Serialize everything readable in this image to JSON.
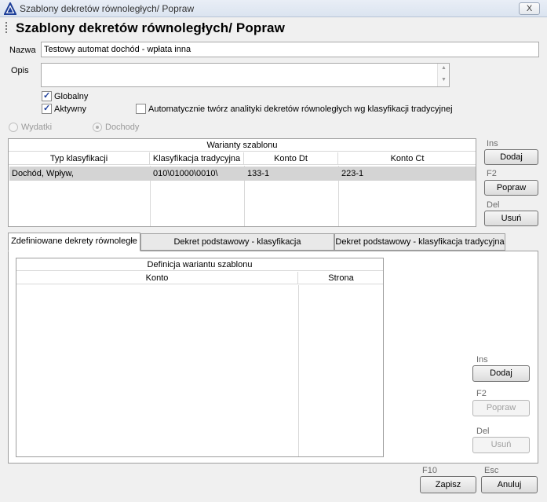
{
  "window": {
    "title": "Szablony dekretów równoległych/ Popraw",
    "close_label": "X"
  },
  "page_title": "Szablony dekretów równoległych/ Popraw",
  "form": {
    "nazwa_label": "Nazwa",
    "nazwa_value": "Testowy automat dochód - wpłata inna",
    "opis_label": "Opis",
    "opis_value": "",
    "globalny_label": "Globalny",
    "globalny_checked": true,
    "aktywny_label": "Aktywny",
    "aktywny_checked": true,
    "auto_label": "Automatycznie twórz analityki dekretów równoległych wg klasyfikacji tradycyjnej",
    "auto_checked": false,
    "wydatki_label": "Wydatki",
    "dochody_label": "Dochody",
    "selected_radio": "Dochody"
  },
  "warianty": {
    "title": "Warianty szablonu",
    "columns": [
      "Typ klasyfikacji",
      "Klasyfikacja tradycyjna",
      "Konto Dt",
      "Konto Ct"
    ],
    "rows": [
      [
        "Dochód, Wpływ,",
        "010\\01000\\0010\\",
        "133-1",
        "223-1"
      ]
    ]
  },
  "side_buttons_top": {
    "ins_hotkey": "Ins",
    "dodaj": "Dodaj",
    "f2_hotkey": "F2",
    "popraw": "Popraw",
    "del_hotkey": "Del",
    "usun": "Usuń"
  },
  "tabs": [
    {
      "label": "Zdefiniowane dekrety równoległe",
      "active": true
    },
    {
      "label": "Dekret podstawowy - klasyfikacja wielowymiarowa",
      "active": false
    },
    {
      "label": "Dekret podstawowy - klasyfikacja tradycyjna",
      "active": false
    }
  ],
  "definicja": {
    "title": "Definicja wariantu szablonu",
    "columns": [
      "Konto",
      "Strona"
    ],
    "rows": []
  },
  "side_buttons_bottom": {
    "ins_hotkey": "Ins",
    "dodaj": "Dodaj",
    "f2_hotkey": "F2",
    "popraw": "Popraw",
    "del_hotkey": "Del",
    "usun": "Usuń"
  },
  "footer": {
    "f10_hotkey": "F10",
    "zapisz": "Zapisz",
    "esc_hotkey": "Esc",
    "anuluj": "Anuluj"
  },
  "icons": {
    "app_logo": "blue-triangle-logo-icon",
    "grip": "dotted-grip-icon",
    "scroll_up": "scroll-up-arrow-icon",
    "scroll_down": "scroll-down-arrow-icon"
  }
}
